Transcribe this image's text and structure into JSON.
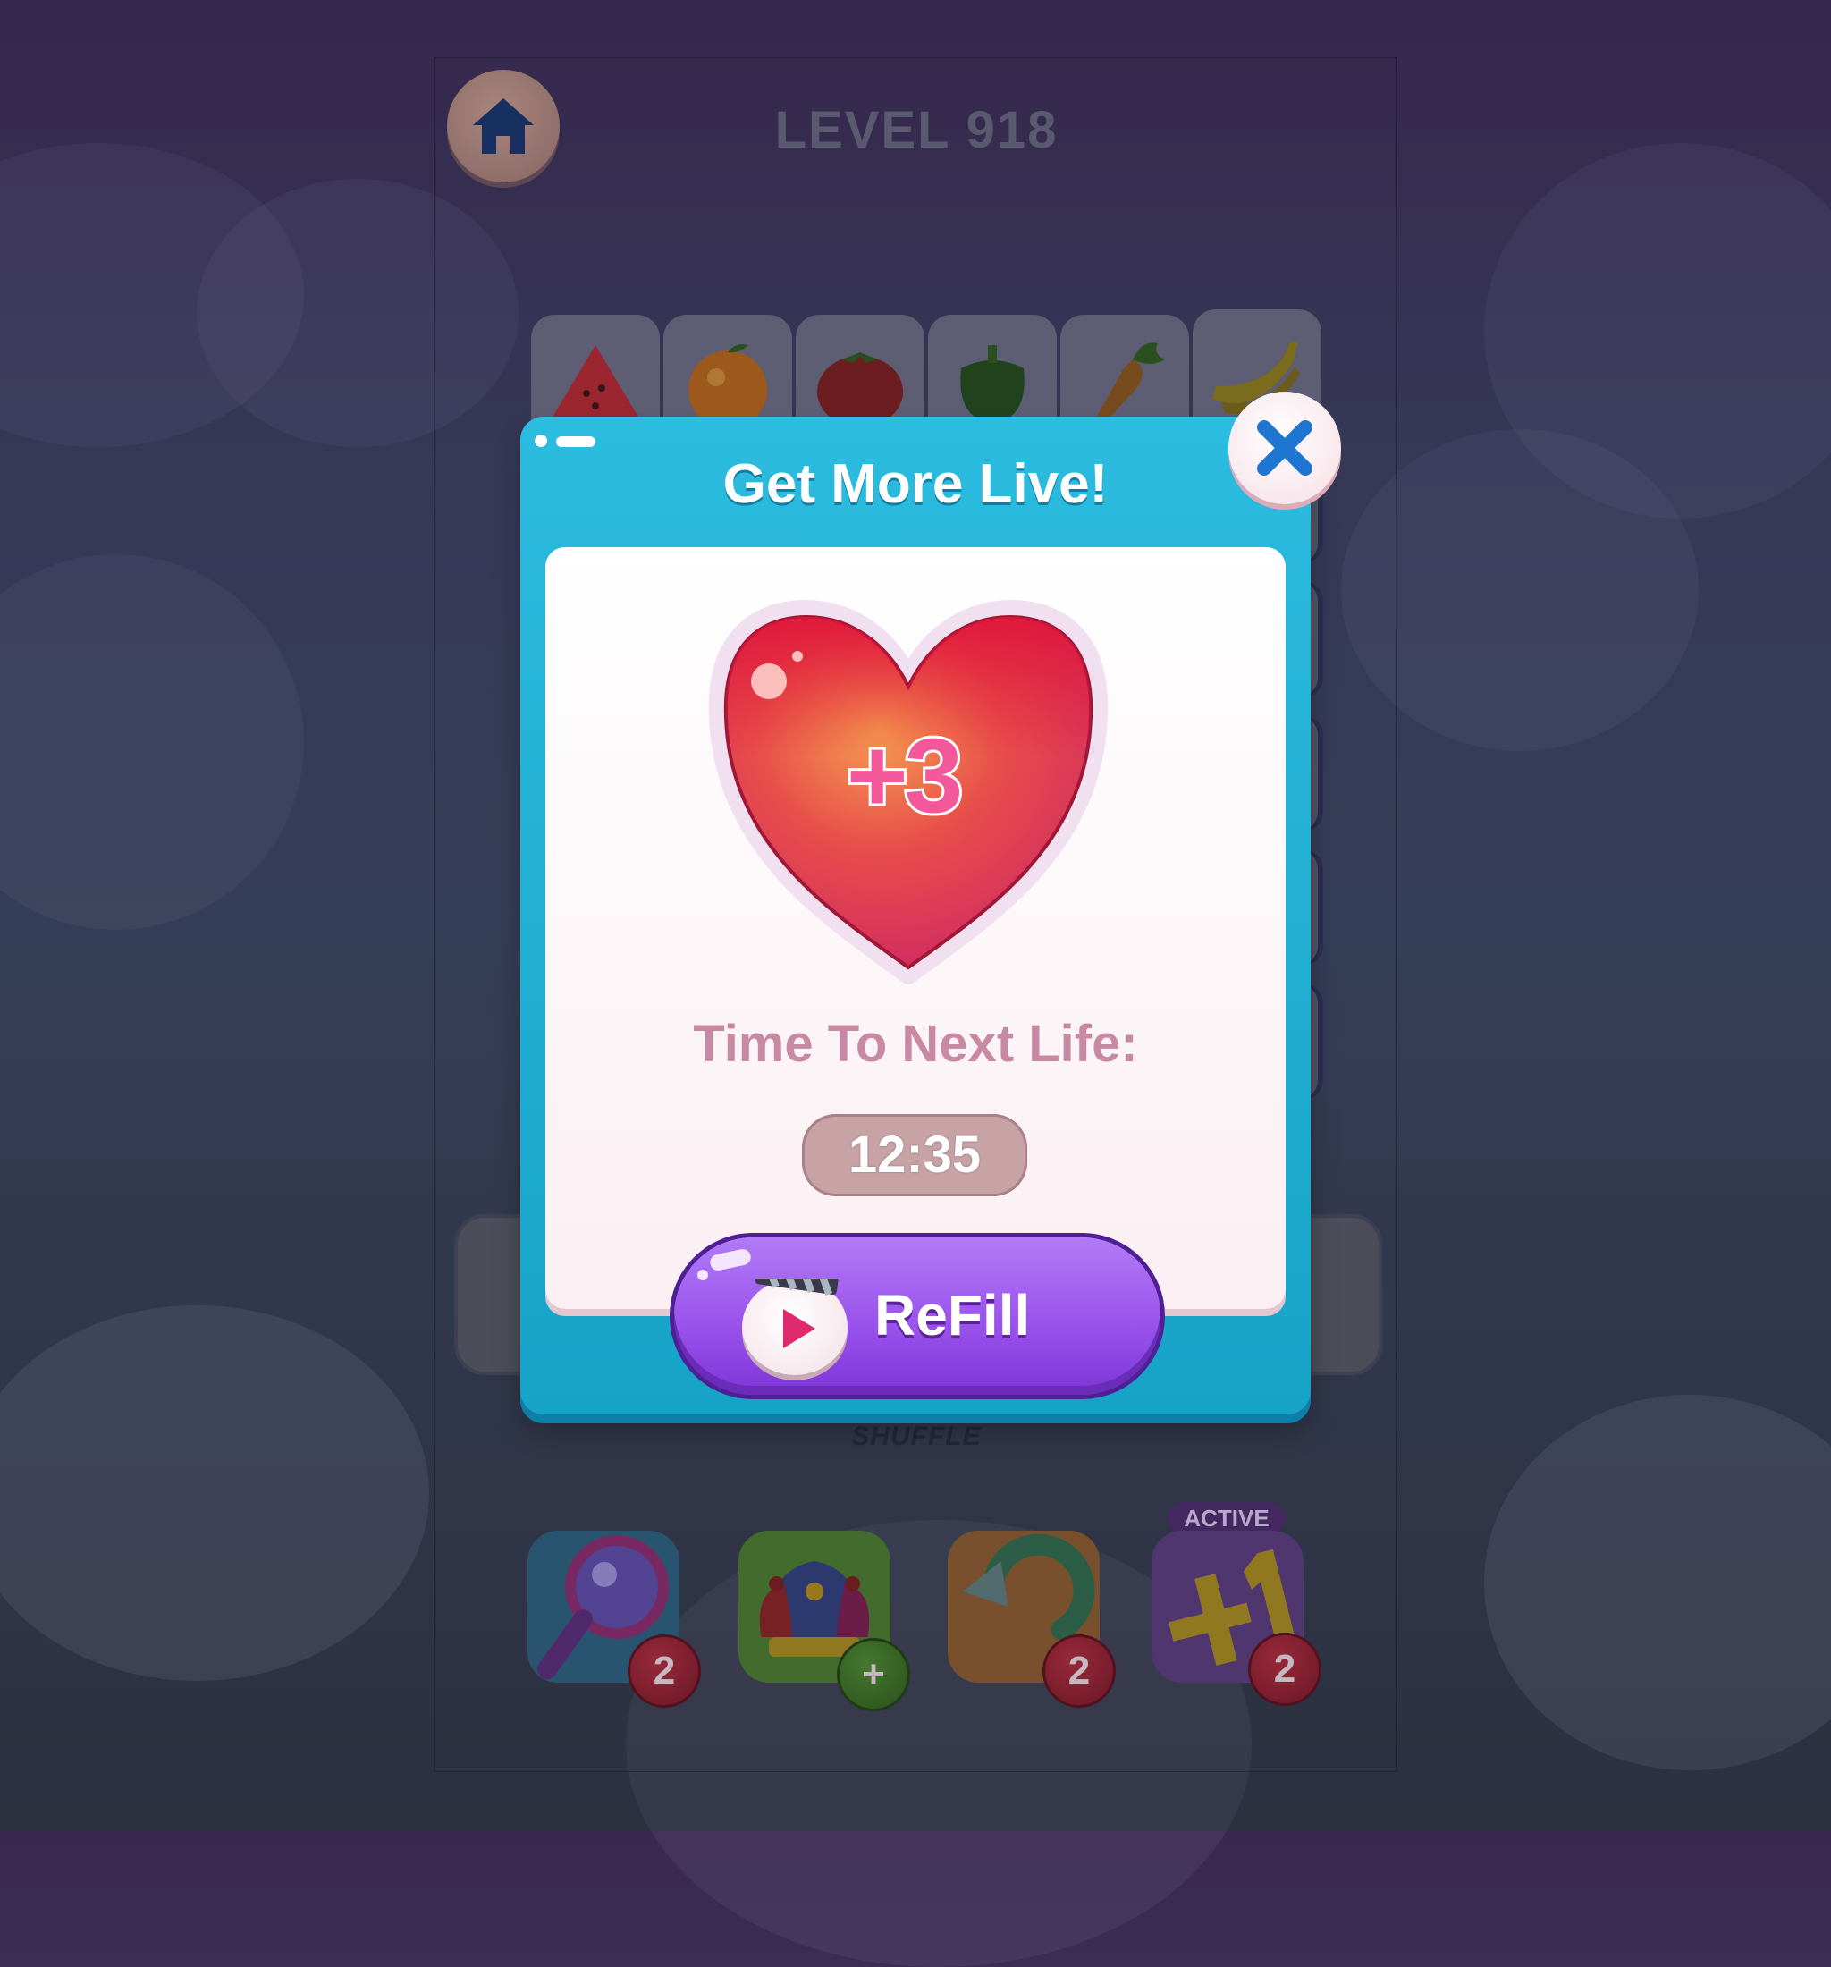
{
  "header": {
    "home_icon": "home-icon",
    "level_title": "LEVEL 918"
  },
  "board": {
    "fruits": [
      "watermelon-icon",
      "orange-icon",
      "tomato-icon",
      "pepper-icon",
      "carrot-icon",
      "banana-icon"
    ]
  },
  "tray": {
    "shuffle_label": "SHUFFLE"
  },
  "boosters": [
    {
      "icon": "magnifier-icon",
      "badge": "2"
    },
    {
      "icon": "jester-hat-icon",
      "badge": "+"
    },
    {
      "icon": "shuffle-arrow-icon",
      "badge": "2"
    },
    {
      "icon": "plus-one-icon",
      "badge": "2",
      "tag": "ACTIVE"
    }
  ],
  "popup": {
    "title": "Get More Live!",
    "heart_label": "+3",
    "next_life_label": "Time To Next Life:",
    "timer": "12:35",
    "refill_label": "ReFill",
    "close_icon": "close-icon"
  },
  "colors": {
    "popup_accent": "#1aa8cc",
    "refill_button": "#9a53ec",
    "heart_top": "#e0143a",
    "heart_bottom": "#d8306e"
  }
}
